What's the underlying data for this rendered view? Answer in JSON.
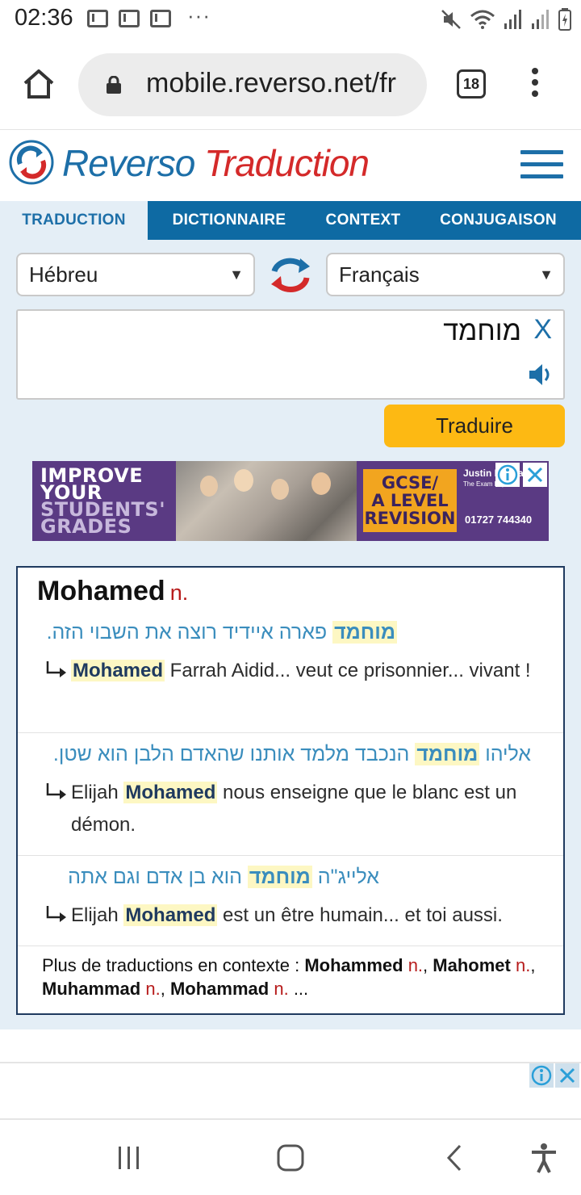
{
  "status_bar": {
    "time": "02:36",
    "dots": "···",
    "icons": [
      "gmail-icon",
      "gmail-icon",
      "gmail-icon",
      "mute-icon",
      "wifi-icon",
      "signal-icon",
      "signal-icon",
      "battery-icon"
    ]
  },
  "browser": {
    "url": "mobile.reverso.net/fr",
    "tab_count": "18"
  },
  "header": {
    "brand_part1": "Reverso",
    "brand_part2": "Traduction"
  },
  "nav": {
    "tabs": [
      {
        "label": "TRADUCTION"
      },
      {
        "label": "DICTIONNAIRE"
      },
      {
        "label": "CONTEXT"
      },
      {
        "label": "CONJUGAISON"
      }
    ]
  },
  "translator": {
    "source_lang": "Hébreu",
    "target_lang": "Français",
    "input_text": "מוחמד",
    "clear_label": "X",
    "translate_button": "Traduire"
  },
  "ad": {
    "left_line1": "IMPROVE",
    "left_line2": "YOUR",
    "left_line3": "STUDENTS'",
    "left_line4": "GRADES",
    "gcse_line1": "GCSE/",
    "gcse_line2": "A LEVEL",
    "gcse_line3": "REVISION",
    "brand": "Justin Education",
    "tagline": "The Exam Experts",
    "phone": "01727 744340"
  },
  "result": {
    "headword": "Mohamed",
    "pos": "n.",
    "examples": [
      {
        "src_before": "",
        "src_highlight": "מוחמד",
        "src_after": " פארה איידיד רוצה את השבוי הזה.",
        "tgt_before": "",
        "tgt_highlight": "Mohamed",
        "tgt_after": " Farrah Aidid... veut ce prisonnier... vivant !"
      },
      {
        "src_before": "אליהו ",
        "src_highlight": "מוחמד",
        "src_after": " הנכבד מלמד אותנו שהאדם הלבן הוא שטן.",
        "tgt_before": "Elijah ",
        "tgt_highlight": "Mohamed",
        "tgt_after": " nous enseigne que le blanc est un démon."
      },
      {
        "src_before": "אלייג\"ה ",
        "src_highlight": "מוחמד",
        "src_after": " הוא בן אדם וגם אתה",
        "tgt_before": "Elijah ",
        "tgt_highlight": "Mohamed",
        "tgt_after": " est un être humain... et toi aussi."
      }
    ],
    "more_prefix": "Plus de traductions en contexte : ",
    "more_items": [
      {
        "word": "Mohammed",
        "pos": "n."
      },
      {
        "word": "Mahomet",
        "pos": "n."
      },
      {
        "word": "Muhammad",
        "pos": "n."
      },
      {
        "word": "Mohammad",
        "pos": "n."
      }
    ],
    "more_suffix": " ..."
  },
  "colors": {
    "brand_blue": "#1d6fa8",
    "brand_red": "#d42a2a",
    "nav_blue": "#0e6aa3",
    "button_yellow": "#fdb913",
    "page_bg": "#e4eef6"
  }
}
